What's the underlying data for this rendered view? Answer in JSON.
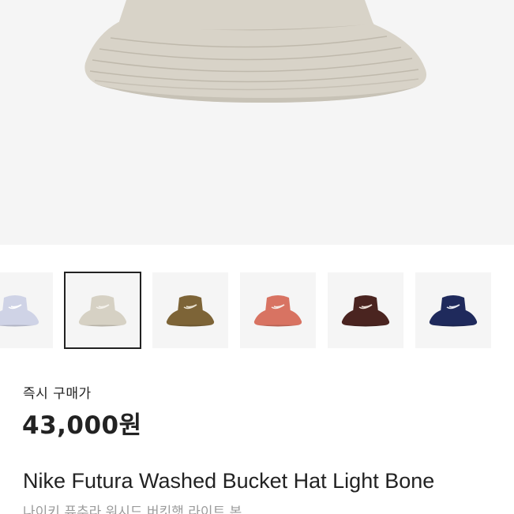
{
  "product": {
    "price_label": "즉시 구매가",
    "price": "43,000원",
    "name_en": "Nike Futura Washed Bucket Hat Light Bone",
    "name_kr": "나이키 퓨추라 워시드 버킷햇 라이트 본"
  },
  "hero": {
    "hat_color": "#d8d3c8"
  },
  "thumbnails": [
    {
      "color": "#cfd3e6",
      "logo": "#ffffff",
      "selected": false
    },
    {
      "color": "#d6d1c4",
      "logo": "#f3f0ea",
      "selected": true
    },
    {
      "color": "#7d6437",
      "logo": "#e8e0cf",
      "selected": false
    },
    {
      "color": "#d87362",
      "logo": "#f6e8e2",
      "selected": false
    },
    {
      "color": "#4a2420",
      "logo": "#e9dcd4",
      "selected": false
    },
    {
      "color": "#1f2a5c",
      "logo": "#e6e8f0",
      "selected": false
    }
  ],
  "colors": {
    "text_primary": "#222222",
    "text_secondary": "#9b9b9b",
    "image_background": "#f5f5f5",
    "selected_border": "#222222"
  }
}
